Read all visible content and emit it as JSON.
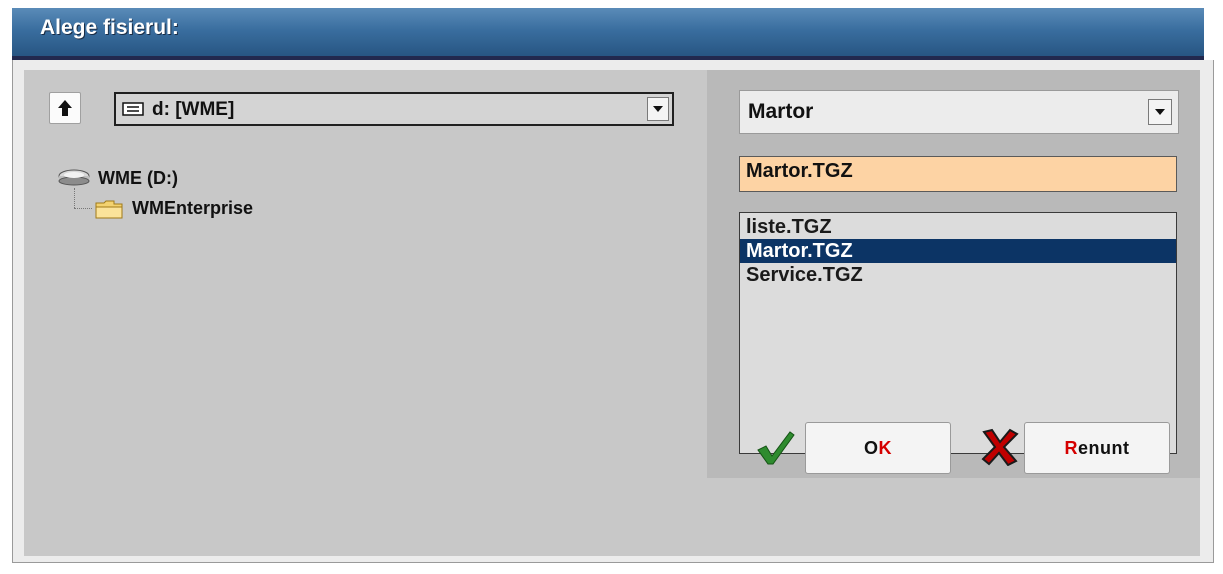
{
  "window": {
    "title": "Alege fisierul:"
  },
  "drive_selector": {
    "value": "d: [WME]",
    "icon": "drive-icon"
  },
  "tree": {
    "root": {
      "label": "WME (D:)",
      "icon": "hard-drive-icon"
    },
    "children": [
      {
        "label": "WMEnterprise",
        "icon": "folder-icon"
      }
    ]
  },
  "archive_selector": {
    "value": "Martor"
  },
  "filename": {
    "value": "Martor.TGZ"
  },
  "files": [
    {
      "name": "liste.TGZ",
      "selected": false
    },
    {
      "name": "Martor.TGZ",
      "selected": true
    },
    {
      "name": "Service.TGZ",
      "selected": false
    }
  ],
  "buttons": {
    "ok": {
      "mnemonic_prefix": "O",
      "mnemonic": "K",
      "rest": ""
    },
    "cancel": {
      "mnemonic_prefix": "",
      "mnemonic": "R",
      "rest": "enunt"
    }
  },
  "colors": {
    "title_bar": "#23507c",
    "filename_bg": "#fdd3a4",
    "selection": "#0c3465",
    "mnemonic": "#d50000",
    "ok_check": "#2e8b2e",
    "cancel_x": "#c00000"
  }
}
